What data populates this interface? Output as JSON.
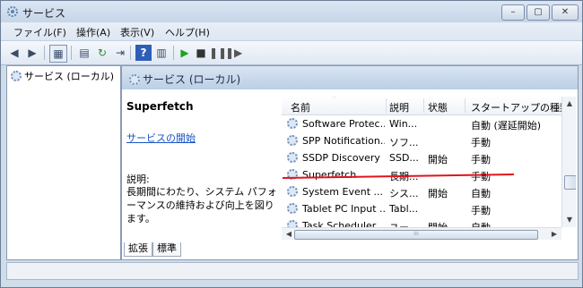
{
  "window": {
    "title": "サービス"
  },
  "controls": {
    "minimize": "–",
    "maximize": "▢",
    "close": "✕"
  },
  "menu": [
    "ファイル(F)",
    "操作(A)",
    "表示(V)",
    "ヘルプ(H)"
  ],
  "toolbar": {
    "icons": [
      "back-icon",
      "forward-icon",
      "console-tree-icon",
      "properties-icon",
      "refresh-icon",
      "export-icon",
      "help-icon",
      "show-hide-icon",
      "play-icon",
      "stop-icon",
      "pause-icon",
      "restart-icon"
    ],
    "accent": "#1fa31f"
  },
  "tree": {
    "item": "サービス (ローカル)"
  },
  "detail": {
    "header": "サービス (ローカル)",
    "service_name": "Superfetch",
    "start_link": "サービスの開始",
    "desc_label": "説明:",
    "desc_text": "長期間にわたり、システム パフォーマンスの維持および向上を図ります。"
  },
  "table": {
    "columns": [
      "名前",
      "説明",
      "状態",
      "スタートアップの種類"
    ],
    "rows": [
      {
        "name": "Software Protec...",
        "desc": "Win...",
        "state": "",
        "startup": "自動 (遅延開始)"
      },
      {
        "name": "SPP Notification...",
        "desc": "ソフ...",
        "state": "",
        "startup": "手動"
      },
      {
        "name": "SSDP Discovery",
        "desc": "SSD...",
        "state": "開始",
        "startup": "手動"
      },
      {
        "name": "Superfetch",
        "desc": "長期...",
        "state": "",
        "startup": "手動"
      },
      {
        "name": "System Event ...",
        "desc": "シス...",
        "state": "開始",
        "startup": "自動"
      },
      {
        "name": "Tablet PC Input ...",
        "desc": "Tabl...",
        "state": "",
        "startup": "手動"
      },
      {
        "name": "Task Scheduler",
        "desc": "ユー...",
        "state": "開始",
        "startup": "自動"
      }
    ]
  },
  "tabs": [
    "拡張",
    "標準"
  ],
  "highlight_color": "#e0141e"
}
